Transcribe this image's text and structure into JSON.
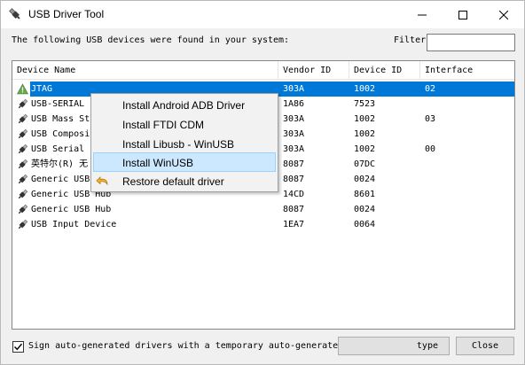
{
  "window": {
    "title": "USB Driver Tool",
    "controls": [
      "minimize",
      "maximize",
      "close"
    ]
  },
  "header": {
    "text": "The following USB devices were found in your system:",
    "filter_label": "Filter",
    "filter_value": ""
  },
  "list": {
    "columns": [
      "Device Name",
      "Vendor ID",
      "Device ID",
      "Interface"
    ],
    "rows": [
      {
        "name": "JTAG",
        "vendor": "303A",
        "device": "1002",
        "iface": "02",
        "icon": "warning-triangle-icon",
        "selected": true
      },
      {
        "name": "USB-SERIAL",
        "vendor": "1A86",
        "device": "7523",
        "iface": "",
        "icon": "usb-plug-icon"
      },
      {
        "name": "USB Mass St",
        "vendor": "303A",
        "device": "1002",
        "iface": "03",
        "icon": "usb-plug-icon"
      },
      {
        "name": "USB Composi",
        "vendor": "303A",
        "device": "1002",
        "iface": "",
        "icon": "usb-plug-icon"
      },
      {
        "name": "USB Serial",
        "vendor": "303A",
        "device": "1002",
        "iface": "00",
        "icon": "usb-plug-icon"
      },
      {
        "name": "英特尔(R) 无",
        "vendor": "8087",
        "device": "07DC",
        "iface": "",
        "icon": "usb-plug-icon"
      },
      {
        "name": "Generic USB",
        "vendor": "8087",
        "device": "0024",
        "iface": "",
        "icon": "usb-plug-icon"
      },
      {
        "name": "Generic USB Hub",
        "vendor": "14CD",
        "device": "8601",
        "iface": "",
        "icon": "usb-plug-icon"
      },
      {
        "name": "Generic USB Hub",
        "vendor": "8087",
        "device": "0024",
        "iface": "",
        "icon": "usb-plug-icon"
      },
      {
        "name": "USB Input Device",
        "vendor": "1EA7",
        "device": "0064",
        "iface": "",
        "icon": "usb-plug-icon"
      }
    ]
  },
  "context_menu": {
    "items": [
      {
        "label": "Install Android ADB Driver"
      },
      {
        "label": "Install FTDI CDM"
      },
      {
        "label": "Install Libusb - WinUSB"
      },
      {
        "label": "Install WinUSB",
        "highlighted": true
      },
      {
        "label": "Restore default driver",
        "icon": "undo-arrow-icon"
      }
    ]
  },
  "footer": {
    "checkbox_checked": true,
    "checkbox_label": "Sign auto-generated drivers with a temporary auto-generated certificate",
    "type_button": "type",
    "close_button": "Close"
  },
  "colors": {
    "selection": "#0078d7",
    "menu_highlight": "#cce8ff",
    "warning": "#6aa84f"
  }
}
